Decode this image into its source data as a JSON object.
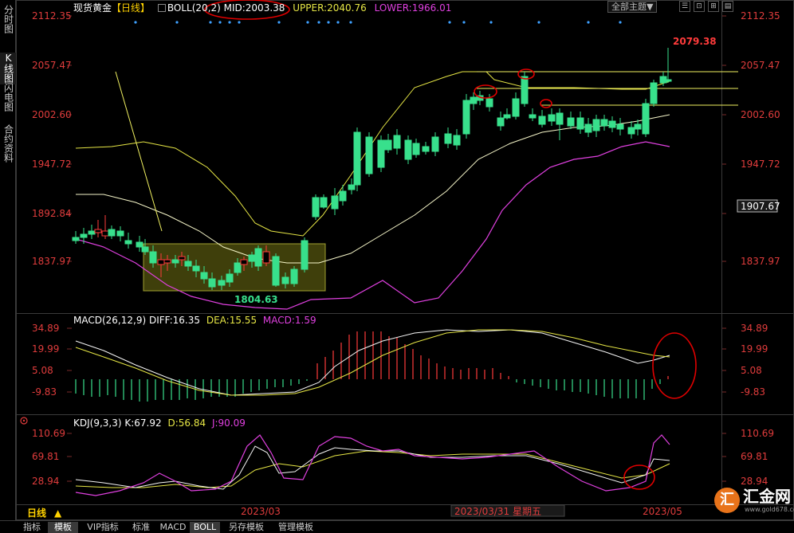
{
  "left_nav": [
    {
      "label": "分时图",
      "active": false
    },
    {
      "label": "K线图",
      "active": true
    },
    {
      "label": "闪电图",
      "active": false
    },
    {
      "label": "合约资料",
      "active": false
    }
  ],
  "header": {
    "symbol": "现货黄金",
    "period": "【日线】",
    "boll_label": "BOLL(20,2)",
    "mid": "MID:2003.38",
    "upper": "UPPER:2040.76",
    "lower": "LOWER:1966.01",
    "theme_button": "全部主题▼",
    "win_buttons": [
      "☰",
      "⊡",
      "⊞",
      "▤"
    ]
  },
  "price_axis": [
    "2112.35",
    "2057.47",
    "2002.60",
    "1947.72",
    "1892.84",
    "1837.97"
  ],
  "price_tags": {
    "current": "1907.67",
    "high_label": "2079.38",
    "low_label": "1804.63"
  },
  "macd": {
    "label": "MACD(26,12,9)",
    "diff": "DIFF:16.35",
    "dea": "DEA:15.55",
    "macd": "MACD:1.59",
    "axis": [
      "34.89",
      "19.99",
      "5.08",
      "-9.83"
    ]
  },
  "kdj": {
    "label": "KDJ(9,3,3)",
    "k": "K:67.92",
    "d": "D:56.84",
    "j": "J:90.09",
    "axis": [
      "110.69",
      "69.81",
      "28.94"
    ]
  },
  "time_axis": {
    "period": "日线",
    "month1": "2023/03",
    "crosshair": "2023/03/31 星期五",
    "month2": "2023/05"
  },
  "bottom_tabs": [
    {
      "label": "指标",
      "active": false
    },
    {
      "label": "模板",
      "active": true
    },
    {
      "label": "VIP指标",
      "active": false
    },
    {
      "label": "标准",
      "active": false
    },
    {
      "label": "MACD",
      "active": false
    },
    {
      "label": "BOLL",
      "active": true
    },
    {
      "label": "另存模板",
      "active": false
    },
    {
      "label": "管理模板",
      "active": false
    }
  ],
  "watermark": {
    "mark": "汇",
    "text": "汇金网",
    "url": "www.gold678.com"
  },
  "colors": {
    "up": "#ff3b3b",
    "down": "#38e08c",
    "mid": "#f5f5c8",
    "upper": "#e6e645",
    "lower": "#e040e0",
    "axis_text": "#e03c3c",
    "header_text": "#ffffff",
    "annotation": "#e00000"
  }
}
